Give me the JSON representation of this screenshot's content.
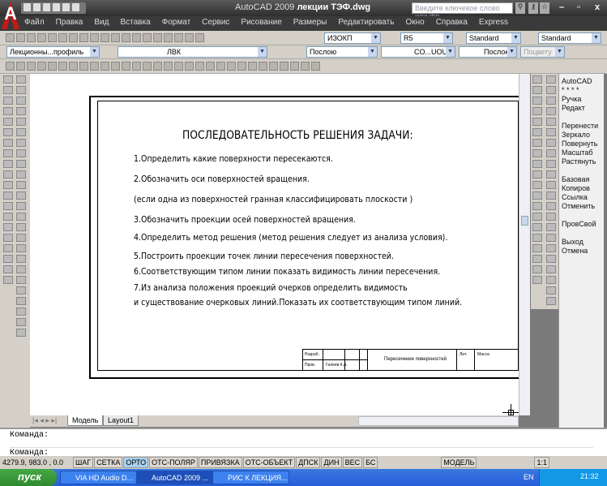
{
  "window": {
    "app": "AutoCAD 2009",
    "file": "лекции ТЭФ.dwg",
    "search_placeholder": "Введите ключевое слово или фр"
  },
  "menu": [
    "Файл",
    "Правка",
    "Вид",
    "Вставка",
    "Формат",
    "Сервис",
    "Рисование",
    "Размеры",
    "Редактировать",
    "Окно",
    "Справка",
    "Express"
  ],
  "toolbar": {
    "text_style": "ИЗОКП",
    "dim_style": "R5",
    "table_style": "Standard",
    "mleader_style": "Standard",
    "workspace": "Лекционны...профиль",
    "layer": "ЛВК",
    "color": "Послою",
    "linetype": "CO...UOUS",
    "lineweight": "Послою",
    "plotstyle": "Поцвету"
  },
  "sheet": {
    "title": "ПОСЛЕДОВАТЕЛЬНОСТЬ РЕШЕНИЯ ЗАДАЧИ:",
    "lines": [
      "1.Определить какие поверхности пересекаются.",
      "2.Обозначить оси поверхностей вращения.",
      "(если одна из поверхностей гранная классифицировать плоскости )",
      "3.Обозначить проекции осей поверхностей вращения.",
      "4.Определить метод решения (метод решения следует из анализа условия).",
      "5.Построить проекции точек линии пересечения поверхностей.",
      "6.Соответствующим типом линии показать видимость линии пересечения.",
      "7.Из анализа положения проекций очерков определить видимость",
      "и существование очерковых линий.Показать их соответствующим типом линий."
    ],
    "stamp": {
      "r1": "Разраб.",
      "r2": "Пров.",
      "name": "Галеев К.А.",
      "caption": "Пересечение поверхностей",
      "lit": "Лит.",
      "mass": "Масса"
    }
  },
  "grip_panel": [
    "AutoCAD",
    "* * * *",
    "Ручка",
    "Редакт",
    "",
    "Перенести",
    "Зеркало",
    "Повернуть",
    "Масштаб",
    "Растянуть",
    "",
    "Базовая",
    "Копиров",
    "Ссылка",
    "Отменить",
    "",
    "ПровСвой",
    "",
    "Выход",
    "Отмена"
  ],
  "tabs": [
    "Модель",
    "Layout1"
  ],
  "command": {
    "line1": "Команда:",
    "line2": "Команда:"
  },
  "status": {
    "coords": "4279.9, 983.0 , 0.0",
    "toggles": [
      "ШАГ",
      "СЕТКА",
      "ОРТО",
      "ОТС-ПОЛЯР",
      "ПРИВЯЗКА",
      "ОТС-ОБЪЕКТ",
      "ДПСК",
      "ДИН",
      "ВЕС",
      "БС"
    ],
    "active": "ОРТО",
    "space": "МОДЕЛЬ",
    "scale": "1:1"
  },
  "taskbar": {
    "start": "пуск",
    "tasks": [
      "VIA HD Audio D...",
      "AutoCAD 2009 ...",
      "РИС К ЛЕКЦИЯ..."
    ],
    "lang": "EN",
    "time": "21:32"
  }
}
